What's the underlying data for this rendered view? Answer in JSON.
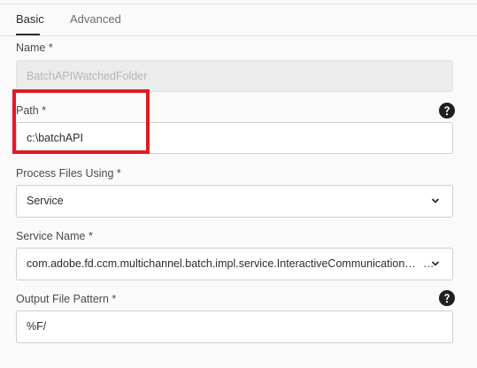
{
  "tabs": [
    {
      "label": "Basic",
      "active": true
    },
    {
      "label": "Advanced",
      "active": false
    }
  ],
  "fields": {
    "name": {
      "label": "Name *",
      "value": "BatchAPIWatchedFolder",
      "disabled": true
    },
    "path": {
      "label": "Path *",
      "value": "c:\\batchAPI"
    },
    "process_files_using": {
      "label": "Process Files Using *",
      "value": "Service"
    },
    "service_name": {
      "label": "Service Name *",
      "value": "com.adobe.fd.ccm.multichannel.batch.impl.service.InteractiveCommunicationBatchServiceImpl"
    },
    "output_file_pattern": {
      "label": "Output File Pattern *",
      "value": "%F/"
    }
  },
  "icons": {
    "help": "help-icon",
    "dropdown": "chevron-down-icon"
  },
  "colors": {
    "highlight": "#e01b22",
    "help_icon": "#1f1f1f"
  }
}
